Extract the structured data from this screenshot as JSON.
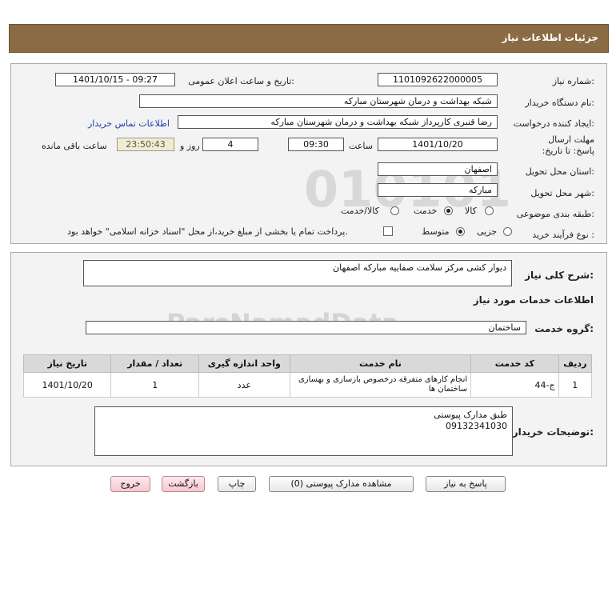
{
  "header": {
    "title": "جزئیات اطلاعات نیاز"
  },
  "form": {
    "need_number_label": "شماره نیاز:",
    "need_number": "1101092622000005",
    "announce_label": "تاریخ و ساعت اعلان عمومی:",
    "announce_value": "1401/10/15 - 09:27",
    "buyer_org_label": "نام دستگاه خریدار:",
    "buyer_org": "شبکه بهداشت و درمان شهرستان مبارکه",
    "requester_label": "ایجاد کننده درخواست:",
    "requester": "رضا قنبری کارپرداز شبکه بهداشت و درمان شهرستان مبارکه",
    "contact_link": "اطلاعات تماس خریدار",
    "deadline_label": "مهلت ارسال پاسخ: تا تاریخ:",
    "deadline_date": "1401/10/20",
    "time_label": "ساعت",
    "deadline_time": "09:30",
    "days_value": "4",
    "days_label": "روز و",
    "remaining_time": "23:50:43",
    "remaining_label": "ساعت باقی مانده",
    "province_label": "استان محل تحویل:",
    "province": "اصفهان",
    "city_label": "شهر محل تحویل:",
    "city": "مبارکه",
    "category_label": "طبقه بندی موضوعی:",
    "category_options": [
      "کالا",
      "خدمت",
      "کالا/خدمت"
    ],
    "category_selected": "خدمت",
    "process_label": "نوع فرآیند خرید :",
    "process_options": [
      "جزیی",
      "متوسط"
    ],
    "process_selected": "متوسط",
    "payment_note": "پرداخت تمام یا بخشی از مبلغ خرید،از محل \"اسناد خزانه اسلامی\" خواهد بود."
  },
  "details": {
    "summary_label": "شرح کلی نیاز:",
    "summary": "دیوار کشی مرکز سلامت صفاییه مبارکه اصفهان",
    "services_title": "اطلاعات خدمات مورد نیاز",
    "service_group_label": "گروه خدمت:",
    "service_group": "ساختمان",
    "table": {
      "headers": [
        "ردیف",
        "کد خدمت",
        "نام خدمت",
        "واحد اندازه گیری",
        "تعداد / مقدار",
        "تاریخ نیاز"
      ],
      "rows": [
        [
          "1",
          "ج-44",
          "انجام کارهای متفرقه درخصوص بازسازی و بهسازی ساختمان ها",
          "عدد",
          "1",
          "1401/10/20"
        ]
      ]
    },
    "buyer_notes_label": "توضیحات خریدار:",
    "buyer_notes_line1": "طبق مدارک پیوستی",
    "buyer_notes_line2": "09132341030"
  },
  "buttons": {
    "reply": "پاسخ به نیاز",
    "attachments": "مشاهده مدارک پیوستی (0)",
    "print": "چاپ",
    "back": "بازگشت",
    "exit": "خروج"
  }
}
